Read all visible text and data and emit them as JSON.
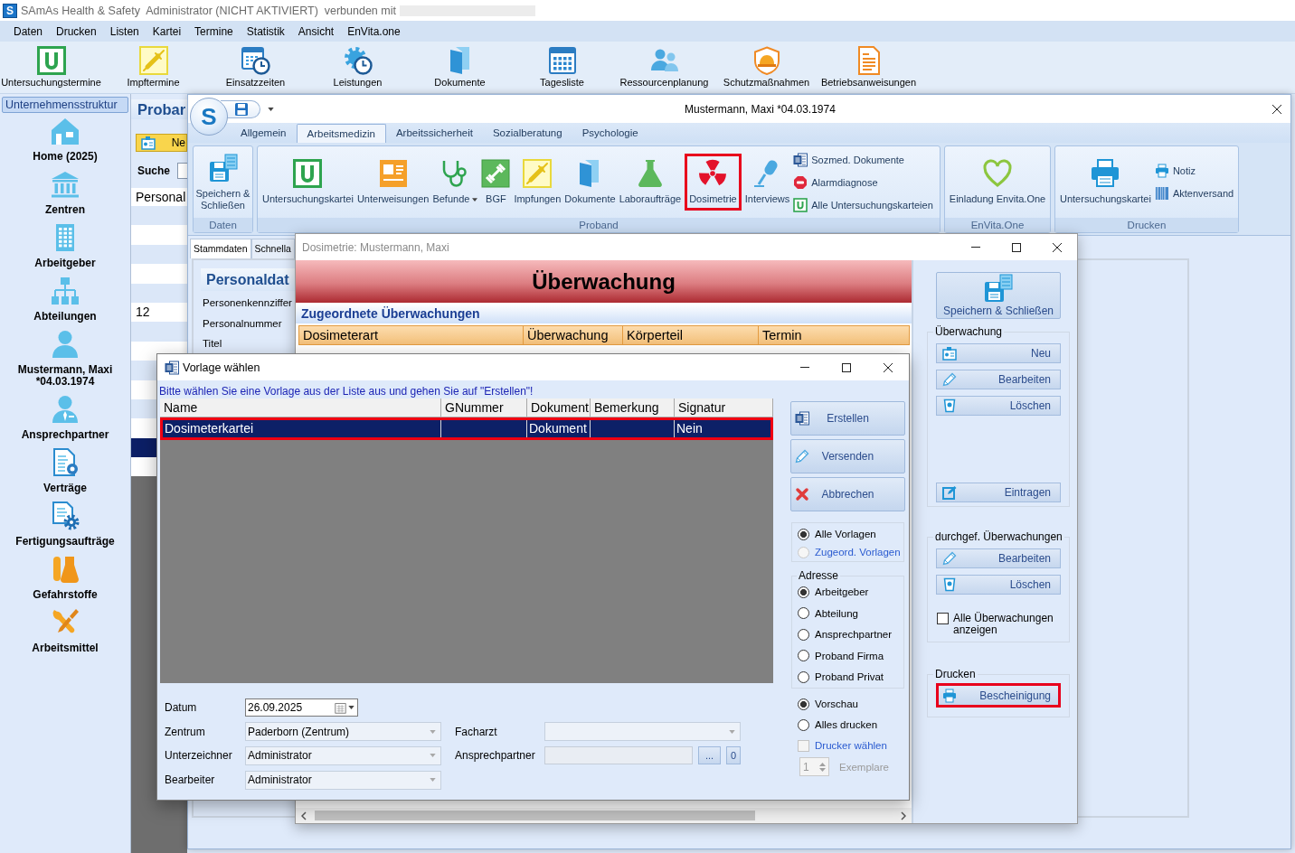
{
  "app_window": {
    "logo": "S",
    "title": "SAmAs Health & Safety  Administrator (NICHT AKTIVIERT)  verbunden mit"
  },
  "menu": [
    "Daten",
    "Drucken",
    "Listen",
    "Kartei",
    "Termine",
    "Statistik",
    "Ansicht",
    "EnVita.one"
  ],
  "toolbar": [
    "Untersuchungstermine",
    "Impftermine",
    "Einsatzzeiten",
    "Leistungen",
    "Dokumente",
    "Tagesliste",
    "Ressourcenplanung",
    "Schutzmaßnahmen",
    "Betriebsanweisungen"
  ],
  "sidebar": {
    "header": "Unternehmensstruktur",
    "items": [
      "Home (2025)",
      "Zentren",
      "Arbeitgeber",
      "Abteilungen",
      "Mustermann, Maxi *04.03.1974",
      "Ansprechpartner",
      "Verträge",
      "Fertigungsaufträge",
      "Gefahrstoffe",
      "Arbeitsmittel"
    ]
  },
  "probanden": {
    "title": "Probar",
    "new_button": "Ne",
    "search_label": "Suche",
    "column_1": "Personal",
    "rows": [
      {
        "selected": false
      },
      {
        "selected": false
      },
      {
        "selected": false
      },
      {
        "selected": false
      },
      {
        "selected": false
      },
      {
        "column_1": "12",
        "selected": false
      },
      {
        "selected": false
      },
      {
        "selected": false
      },
      {
        "selected": false
      },
      {
        "selected": false
      },
      {
        "selected": false
      },
      {
        "selected": false
      },
      {
        "selected": true
      },
      {
        "selected": false
      }
    ]
  },
  "patient_window": {
    "orb": "S",
    "title": "Mustermann, Maxi *04.03.1974",
    "ribbon_tabs": [
      {
        "label": "Allgemein",
        "selected": false
      },
      {
        "label": "Arbeitsmedizin",
        "selected": true
      },
      {
        "label": "Arbeitssicherheit",
        "selected": false
      },
      {
        "label": "Sozialberatung",
        "selected": false
      },
      {
        "label": "Psychologie",
        "selected": false
      }
    ],
    "ribbon_groups": [
      {
        "label": "Daten",
        "items": [
          {
            "label": "Speichern & Schließen",
            "kind": "large",
            "highlighted": false
          }
        ]
      },
      {
        "label": "Proband",
        "items": [
          {
            "label": "Untersuchungskartei",
            "kind": "large",
            "highlighted": false
          },
          {
            "label": "Unterweisungen",
            "kind": "large",
            "highlighted": false
          },
          {
            "label": "Befunde",
            "kind": "dropdown",
            "highlighted": false
          },
          {
            "label": "BGF",
            "kind": "large",
            "highlighted": false
          },
          {
            "label": "Impfungen",
            "kind": "large",
            "highlighted": false
          },
          {
            "label": "Dokumente",
            "kind": "large",
            "highlighted": false
          },
          {
            "label": "Laboraufträge",
            "kind": "large",
            "highlighted": false
          },
          {
            "label": "Dosimetrie",
            "kind": "large",
            "highlighted": true
          },
          {
            "label": "Interviews",
            "kind": "large",
            "highlighted": false
          },
          {
            "label": "Sozmed. Dokumente",
            "kind": "small",
            "highlighted": false
          },
          {
            "label": "Alarmdiagnose",
            "kind": "small",
            "highlighted": false
          },
          {
            "label": "Alle Untersuchungskarteien",
            "kind": "small",
            "highlighted": false
          }
        ]
      },
      {
        "label": "EnVita.One",
        "items": [
          {
            "label": "Einladung Envita.One",
            "kind": "large",
            "highlighted": false
          }
        ]
      },
      {
        "label": "Drucken",
        "items": [
          {
            "label": "Untersuchungskartei",
            "kind": "large",
            "highlighted": false
          },
          {
            "label": "Notiz",
            "kind": "small",
            "highlighted": false
          },
          {
            "label": "Aktenversand",
            "kind": "small",
            "highlighted": false
          }
        ]
      }
    ],
    "content_tabs": [
      {
        "label": "Stammdaten",
        "selected": true
      },
      {
        "label": "Schnella",
        "selected": false
      }
    ],
    "section_title": "Personaldat",
    "field_labels": [
      "Personenkennziffer",
      "Personalnummer",
      "Titel"
    ]
  },
  "dosimetrie_window": {
    "title": "Dosimetrie: Mustermann, Maxi",
    "banner": "Überwachung",
    "section_title": "Zugeordnete Überwachungen",
    "columns": [
      "Dosimeterart",
      "Überwachung",
      "Körperteil",
      "Termin"
    ],
    "save_button": "Speichern & Schließen",
    "groups": [
      {
        "title": "Überwachung",
        "buttons": [
          {
            "label": "Neu",
            "highlighted": false
          },
          {
            "label": "Bearbeiten",
            "highlighted": false
          },
          {
            "label": "Löschen",
            "highlighted": false
          }
        ],
        "bottom_buttons": [
          {
            "label": "Eintragen",
            "highlighted": false
          }
        ]
      },
      {
        "title": "durchgef. Überwachungen",
        "buttons": [
          {
            "label": "Bearbeiten",
            "highlighted": false
          },
          {
            "label": "Löschen",
            "highlighted": false
          }
        ],
        "checkbox": {
          "label": "Alle Überwachungen anzeigen",
          "checked": false
        }
      },
      {
        "title": "Drucken",
        "buttons": [
          {
            "label": "Bescheinigung",
            "highlighted": true
          }
        ]
      }
    ]
  },
  "vorlage_dialog": {
    "title": "Vorlage wählen",
    "instruction": "Bitte wählen Sie eine Vorlage aus der Liste aus und gehen Sie auf \"Erstellen\"!",
    "columns": [
      "Name",
      "GNummer",
      "Dokument",
      "Bemerkung",
      "Signatur"
    ],
    "rows": [
      {
        "name": "Dosimeterkartei",
        "dokument": "Dokument",
        "signatur": "Nein",
        "selected": true,
        "highlighted": true
      }
    ],
    "buttons": [
      "Erstellen",
      "Versenden",
      "Abbrechen"
    ],
    "template_filter": [
      {
        "label": "Alle Vorlagen",
        "selected": true,
        "disabled": false
      },
      {
        "label": "Zugeord. Vorlagen",
        "selected": false,
        "disabled": true
      }
    ],
    "address": {
      "title": "Adresse",
      "options": [
        {
          "label": "Arbeitgeber",
          "selected": true
        },
        {
          "label": "Abteilung",
          "selected": false
        },
        {
          "label": "Ansprechpartner",
          "selected": false
        },
        {
          "label": "Proband Firma",
          "selected": false
        },
        {
          "label": "Proband Privat",
          "selected": false
        }
      ]
    },
    "output": [
      {
        "label": "Vorschau",
        "selected": true
      },
      {
        "label": "Alles drucken",
        "selected": false
      }
    ],
    "printer_choice": {
      "label": "Drucker wählen",
      "checked": false,
      "disabled": true
    },
    "copies": {
      "value": "1",
      "label": "Exemplare",
      "disabled": true
    },
    "form_left": [
      {
        "label": "Datum",
        "value": "26.09.2025",
        "kind": "date"
      },
      {
        "label": "Zentrum",
        "value": "Paderborn (Zentrum)",
        "kind": "combo"
      },
      {
        "label": "Unterzeichner",
        "value": "Administrator",
        "kind": "combo"
      },
      {
        "label": "Bearbeiter",
        "value": "Administrator",
        "kind": "combo"
      }
    ],
    "form_right": [
      {
        "label": "Facharzt",
        "kind": "combo"
      },
      {
        "label": "Ansprechpartner",
        "kind": "lookup",
        "buttons": [
          "...",
          "0"
        ]
      }
    ]
  }
}
